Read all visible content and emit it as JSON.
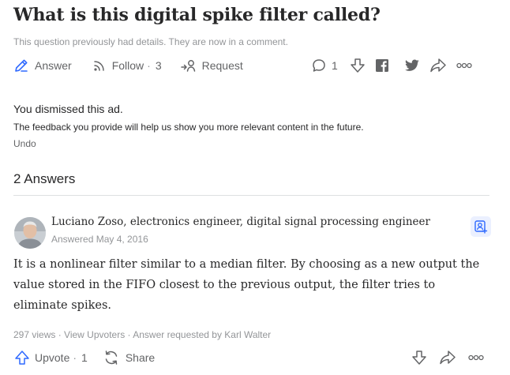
{
  "question": {
    "title": "What is this digital spike filter called?",
    "note": "This question previously had details. They are now in a comment."
  },
  "question_actions": {
    "answer_label": "Answer",
    "follow_label": "Follow",
    "follow_sep": "·",
    "follow_count": "3",
    "request_label": "Request",
    "comment_count": "1"
  },
  "ad_notice": {
    "title": "You dismissed this ad.",
    "text": "The feedback you provide will help us show you more relevant content in the future.",
    "undo_label": "Undo"
  },
  "answers_header": "2 Answers",
  "answer": {
    "author": "Luciano Zoso, electronics engineer, digital signal processing engineer",
    "date": "Answered May 4, 2016",
    "lines": [
      "It is a nonlinear filter similar to a median filter. By choosing as a new output the",
      "value stored in the FIFO closest to the previous output, the filter tries  to",
      "eliminate spikes."
    ],
    "views": "297 views",
    "meta_sep": " · ",
    "view_upvoters": "View Upvoters",
    "requested_by": "Answer requested by Karl Walter",
    "upvote_label": "Upvote",
    "upvote_count": "1",
    "share_label": "Share"
  },
  "colors": {
    "accent_blue": "#2e69ff",
    "icon_grey": "#636466",
    "text_muted": "#939598"
  },
  "icons": [
    "answer-pencil-icon",
    "follow-rss-icon",
    "request-person-icon",
    "comment-bubble-icon",
    "downvote-arrow-icon",
    "facebook-icon",
    "twitter-icon",
    "share-arrow-icon",
    "more-dots-icon",
    "follow-user-icon",
    "upvote-arrow-icon",
    "share-circular-icon"
  ]
}
